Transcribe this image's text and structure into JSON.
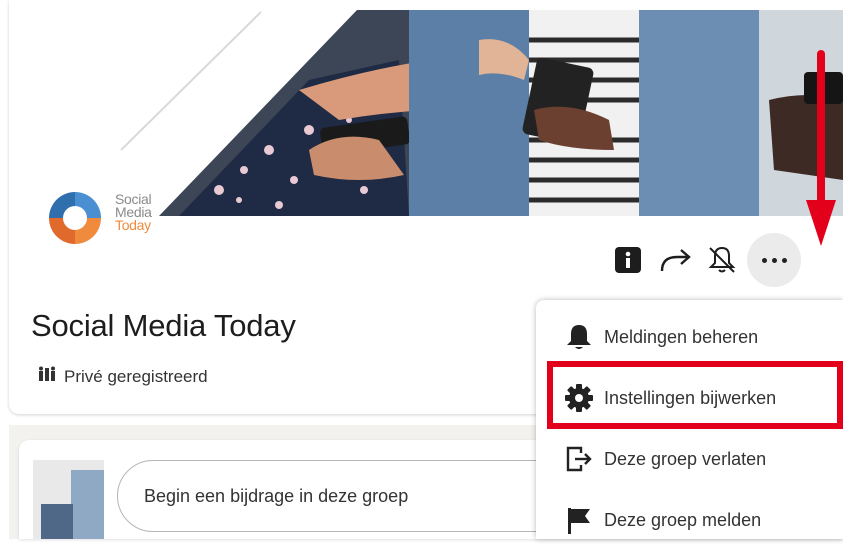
{
  "group": {
    "title": "Social Media Today",
    "privacy": "Privé geregistreerd",
    "logo": {
      "line1": "Social",
      "line2": "Media",
      "line3": "Today"
    }
  },
  "actions": {
    "info_icon": "info-icon",
    "share_icon": "share-arrow-icon",
    "bell_icon": "bell-off-icon",
    "more_icon": "more-dots-icon"
  },
  "menu": {
    "items": [
      {
        "label": "Meldingen beheren",
        "icon": "bell-icon"
      },
      {
        "label": "Instellingen bijwerken",
        "icon": "gear-icon"
      },
      {
        "label": "Deze groep verlaten",
        "icon": "leave-icon"
      },
      {
        "label": "Deze groep melden",
        "icon": "flag-icon"
      }
    ]
  },
  "composer": {
    "placeholder": "Begin een bijdrage in deze groep"
  },
  "colors": {
    "highlight": "#e3001b",
    "arrow": "#e3001b"
  }
}
